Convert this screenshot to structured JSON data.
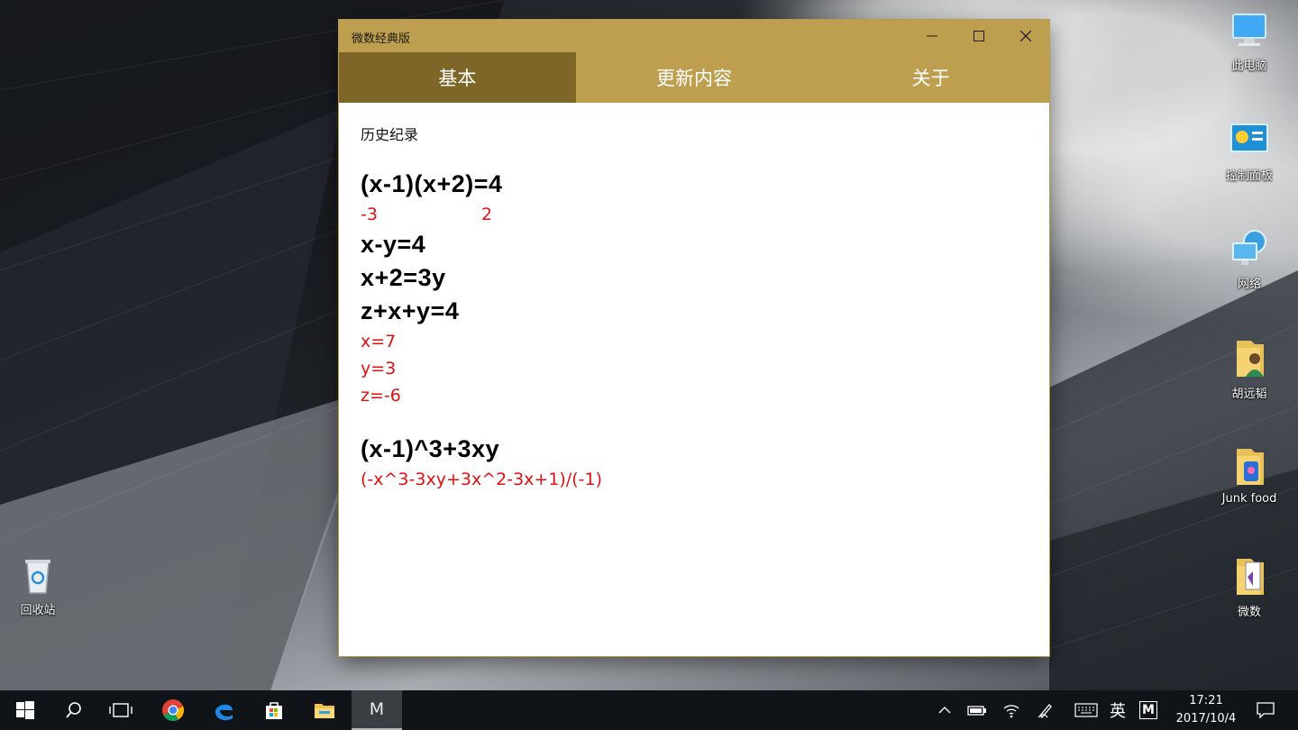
{
  "desktop": {
    "icons": [
      {
        "label": "此电脑",
        "icon": "computer-icon"
      },
      {
        "label": "控制面板",
        "icon": "control-panel-icon"
      },
      {
        "label": "网络",
        "icon": "network-icon"
      },
      {
        "label": "胡远韬",
        "icon": "user-folder-icon"
      },
      {
        "label": "Junk food",
        "icon": "folder-icon"
      },
      {
        "label": "微数",
        "icon": "folder-icon"
      },
      {
        "label": "回收站",
        "icon": "recycle-bin-icon"
      }
    ]
  },
  "window": {
    "title": "微数经典版",
    "tabs": [
      {
        "label": "基本",
        "active": true
      },
      {
        "label": "更新内容",
        "active": false
      },
      {
        "label": "关于",
        "active": false
      }
    ],
    "history": {
      "title": "历史纪录",
      "entries": [
        {
          "equations": [
            "(x-1)(x+2)=4"
          ],
          "results": [
            "-3",
            "2"
          ]
        },
        {
          "equations": [
            "x-y=4",
            "x+2=3y",
            "z+x+y=4"
          ],
          "results": [
            "x=7",
            "y=3",
            "z=-6"
          ]
        },
        {
          "equations": [
            "(x-1)^3+3xy"
          ],
          "results": [
            "(-x^3-3xy+3x^2-3x+1)/(-1)"
          ]
        }
      ]
    }
  },
  "taskbar": {
    "app_label": "M",
    "ime_label": "英",
    "ime_mode": "M",
    "time": "17:21",
    "date": "2017/10/4"
  },
  "colors": {
    "accent": "#bd9f4f",
    "tab_active": "#7e6628",
    "result_red": "#e01010"
  }
}
